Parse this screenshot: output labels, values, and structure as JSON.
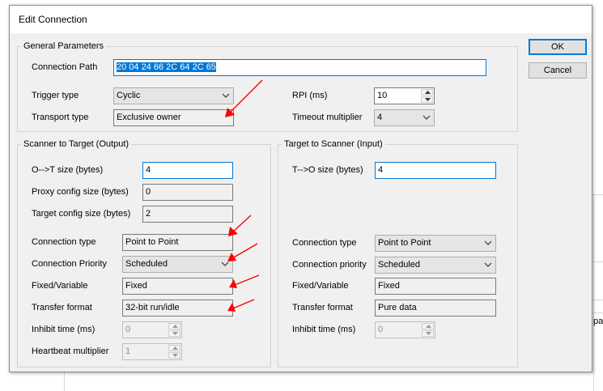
{
  "background": {
    "partial_text": "pai"
  },
  "dialog": {
    "title": "Edit Connection",
    "ok_label": "OK",
    "cancel_label": "Cancel"
  },
  "general": {
    "legend": "General Parameters",
    "connection_path_label": "Connection Path",
    "connection_path_value": "20 04 24 66 2C 64 2C 65",
    "trigger_type_label": "Trigger type",
    "trigger_type_value": "Cyclic",
    "transport_type_label": "Transport type",
    "transport_type_value": "Exclusive owner",
    "rpi_label": "RPI (ms)",
    "rpi_value": "10",
    "timeout_label": "Timeout multiplier",
    "timeout_value": "4"
  },
  "output": {
    "legend": "Scanner to Target (Output)",
    "ot_size_label": "O-->T size (bytes)",
    "ot_size_value": "4",
    "proxy_label": "Proxy config size (bytes)",
    "proxy_value": "0",
    "target_cfg_label": "Target config size (bytes)",
    "target_cfg_value": "2",
    "conn_type_label": "Connection type",
    "conn_type_value": "Point to Point",
    "conn_priority_label": "Connection Priority",
    "conn_priority_value": "Scheduled",
    "fixed_label": "Fixed/Variable",
    "fixed_value": "Fixed",
    "transfer_label": "Transfer format",
    "transfer_value": "32-bit run/idle",
    "inhibit_label": "Inhibit time (ms)",
    "inhibit_value": "0",
    "heartbeat_label": "Heartbeat multiplier",
    "heartbeat_value": "1"
  },
  "input": {
    "legend": "Target to Scanner (Input)",
    "to_size_label": "T-->O size (bytes)",
    "to_size_value": "4",
    "conn_type_label": "Connection type",
    "conn_type_value": "Point to Point",
    "conn_priority_label": "Connection priority",
    "conn_priority_value": "Scheduled",
    "fixed_label": "Fixed/Variable",
    "fixed_value": "Fixed",
    "transfer_label": "Transfer format",
    "transfer_value": "Pure data",
    "inhibit_label": "Inhibit time (ms)",
    "inhibit_value": "0"
  },
  "annotations": {
    "arrow_color": "#ff0000"
  }
}
